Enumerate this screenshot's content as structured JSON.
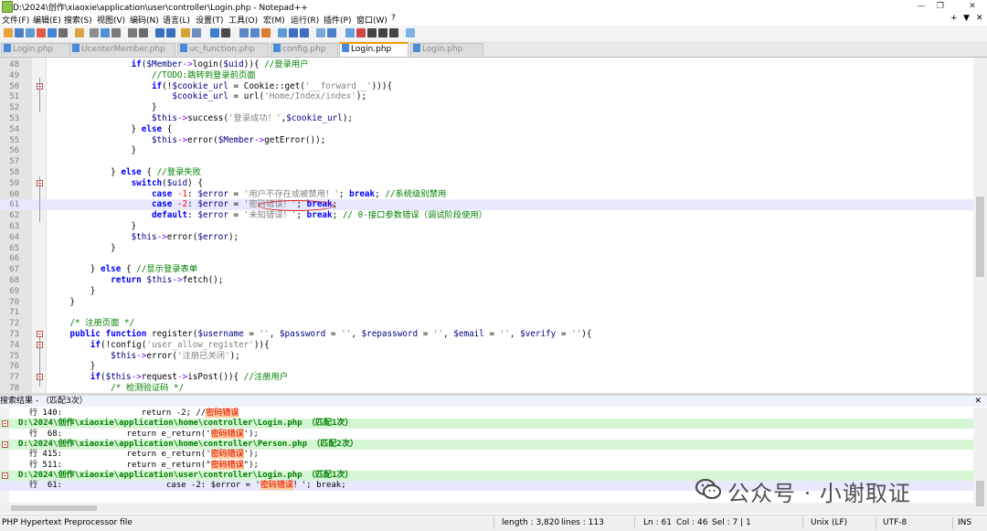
{
  "window": {
    "title": "D:\\2024\\创作\\xiaoxie\\application\\user\\controller\\Login.php - Notepad++",
    "minimize": "—",
    "restore": "❐",
    "close": "✕"
  },
  "menu": {
    "items": [
      "文件(F)",
      "编辑(E)",
      "搜索(S)",
      "视图(V)",
      "编码(N)",
      "语言(L)",
      "设置(T)",
      "工具(O)",
      "宏(M)",
      "运行(R)",
      "插件(P)",
      "窗口(W)",
      "?"
    ],
    "right": [
      "+",
      "▼",
      "✕"
    ]
  },
  "toolbar": {
    "icon_colors": [
      "#e8a33b",
      "#4a7fc9",
      "#5a9bd5",
      "#e05a4a",
      "#3f86d6",
      "#6e6e6e",
      "#d9a441",
      "#8c8c8c",
      "#4f8fd8",
      "#7a7a7a",
      "#7a7a7a",
      "#6b6b6b",
      "#3a6fc0",
      "#3a6fc0",
      "#d6a235",
      "#6b8fbf",
      "#3d7fd0",
      "#4a4a4a",
      "#5a87c7",
      "#5a87c7",
      "#d97c2b",
      "#5f9ad8",
      "#3f6dc4",
      "#3f6dc4",
      "#78a8d8",
      "#4a7fc9",
      "#66a0e0",
      "#d24545",
      "#444444",
      "#444444",
      "#444444",
      "#7fb2e5"
    ]
  },
  "tabs": [
    {
      "label": "Login.php",
      "active": false
    },
    {
      "label": "UcenterMember.php",
      "active": false
    },
    {
      "label": "uc_function.php",
      "active": false
    },
    {
      "label": "config.php",
      "active": false
    },
    {
      "label": "Login.php",
      "active": true
    },
    {
      "label": "Login.php",
      "active": false
    }
  ],
  "tab_scroll": [
    "◀",
    "▶",
    "✕"
  ],
  "editor": {
    "current_line": 61,
    "lines": [
      {
        "n": "48",
        "fold": "none",
        "tokens": [
          [
            "f",
            "                "
          ],
          [
            "k",
            "if"
          ],
          [
            "f",
            "("
          ],
          [
            "v",
            "$Member"
          ],
          [
            "o",
            "->"
          ],
          [
            "f",
            "login("
          ],
          [
            "v",
            "$uid"
          ],
          [
            "f",
            ")){ "
          ],
          [
            "c",
            "//登录用户"
          ]
        ]
      },
      {
        "n": "49",
        "fold": "none",
        "tokens": [
          [
            "c",
            "                    //TODO:跳转到登录前页面"
          ]
        ]
      },
      {
        "n": "50",
        "fold": "open",
        "tokens": [
          [
            "f",
            "                    "
          ],
          [
            "k",
            "if"
          ],
          [
            "f",
            "(!"
          ],
          [
            "v",
            "$cookie_url"
          ],
          [
            "f",
            " = Cookie::get("
          ],
          [
            "s",
            "'__forward__'"
          ],
          [
            "f",
            "))){"
          ]
        ]
      },
      {
        "n": "51",
        "fold": "none",
        "tokens": [
          [
            "f",
            "                        "
          ],
          [
            "v",
            "$cookie_url"
          ],
          [
            "f",
            " = url("
          ],
          [
            "s",
            "'Home/Index/index'"
          ],
          [
            "f",
            ");"
          ]
        ]
      },
      {
        "n": "52",
        "fold": "none",
        "tokens": [
          [
            "f",
            "                    }"
          ]
        ]
      },
      {
        "n": "53",
        "fold": "none",
        "tokens": [
          [
            "f",
            "                    "
          ],
          [
            "v",
            "$this"
          ],
          [
            "o",
            "->"
          ],
          [
            "f",
            "success("
          ],
          [
            "s",
            "'登录成功！'"
          ],
          [
            "f",
            ","
          ],
          [
            "v",
            "$cookie_url"
          ],
          [
            "f",
            ");"
          ]
        ]
      },
      {
        "n": "54",
        "fold": "none",
        "tokens": [
          [
            "f",
            "                } "
          ],
          [
            "k",
            "else"
          ],
          [
            "f",
            " {"
          ]
        ]
      },
      {
        "n": "55",
        "fold": "none",
        "tokens": [
          [
            "f",
            "                    "
          ],
          [
            "v",
            "$this"
          ],
          [
            "o",
            "->"
          ],
          [
            "f",
            "error("
          ],
          [
            "v",
            "$Member"
          ],
          [
            "o",
            "->"
          ],
          [
            "f",
            "getError());"
          ]
        ]
      },
      {
        "n": "56",
        "fold": "none",
        "tokens": [
          [
            "f",
            "                }"
          ]
        ]
      },
      {
        "n": "57",
        "fold": "none",
        "tokens": []
      },
      {
        "n": "58",
        "fold": "none",
        "tokens": [
          [
            "f",
            "            } "
          ],
          [
            "k",
            "else"
          ],
          [
            "f",
            " { "
          ],
          [
            "c",
            "//登录失败"
          ]
        ]
      },
      {
        "n": "59",
        "fold": "open",
        "tokens": [
          [
            "f",
            "                "
          ],
          [
            "k",
            "switch"
          ],
          [
            "f",
            "("
          ],
          [
            "v",
            "$uid"
          ],
          [
            "f",
            ") {"
          ]
        ]
      },
      {
        "n": "60",
        "fold": "none",
        "tokens": [
          [
            "f",
            "                    "
          ],
          [
            "k",
            "case"
          ],
          [
            "f",
            " "
          ],
          [
            "n",
            "-1"
          ],
          [
            "f",
            ": "
          ],
          [
            "v",
            "$error"
          ],
          [
            "f",
            " = "
          ],
          [
            "s",
            "'用户不存在或被禁用！'"
          ],
          [
            "f",
            "; "
          ],
          [
            "k",
            "break"
          ],
          [
            "f",
            "; "
          ],
          [
            "c",
            "//系统级别禁用"
          ]
        ]
      },
      {
        "n": "61",
        "fold": "none",
        "tokens": [
          [
            "f",
            "                    "
          ],
          [
            "k",
            "case"
          ],
          [
            "f",
            " "
          ],
          [
            "n",
            "-2"
          ],
          [
            "f",
            ": "
          ],
          [
            "v",
            "$error"
          ],
          [
            "f",
            " = "
          ],
          [
            "s",
            "'密码错误！'"
          ],
          [
            "f",
            "; "
          ],
          [
            "k",
            "break"
          ],
          [
            "f",
            ";"
          ]
        ]
      },
      {
        "n": "62",
        "fold": "none",
        "tokens": [
          [
            "f",
            "                    "
          ],
          [
            "k",
            "default"
          ],
          [
            "f",
            ": "
          ],
          [
            "v",
            "$error"
          ],
          [
            "f",
            " = "
          ],
          [
            "s",
            "'未知错误！'"
          ],
          [
            "f",
            "; "
          ],
          [
            "k",
            "break"
          ],
          [
            "f",
            "; "
          ],
          [
            "c",
            "// 0-接口参数错误（调试阶段使用）"
          ]
        ]
      },
      {
        "n": "63",
        "fold": "none",
        "tokens": [
          [
            "f",
            "                }"
          ]
        ]
      },
      {
        "n": "64",
        "fold": "none",
        "tokens": [
          [
            "f",
            "                "
          ],
          [
            "v",
            "$this"
          ],
          [
            "o",
            "->"
          ],
          [
            "f",
            "error("
          ],
          [
            "v",
            "$error"
          ],
          [
            "f",
            ");"
          ]
        ]
      },
      {
        "n": "65",
        "fold": "none",
        "tokens": [
          [
            "f",
            "            }"
          ]
        ]
      },
      {
        "n": "66",
        "fold": "none",
        "tokens": []
      },
      {
        "n": "67",
        "fold": "none",
        "tokens": [
          [
            "f",
            "        } "
          ],
          [
            "k",
            "else"
          ],
          [
            "f",
            " { "
          ],
          [
            "c",
            "//显示登录表单"
          ]
        ]
      },
      {
        "n": "68",
        "fold": "none",
        "tokens": [
          [
            "f",
            "            "
          ],
          [
            "k",
            "return"
          ],
          [
            "f",
            " "
          ],
          [
            "v",
            "$this"
          ],
          [
            "o",
            "->"
          ],
          [
            "f",
            "fetch();"
          ]
        ]
      },
      {
        "n": "69",
        "fold": "none",
        "tokens": [
          [
            "f",
            "        }"
          ]
        ]
      },
      {
        "n": "70",
        "fold": "none",
        "tokens": [
          [
            "f",
            "    }"
          ]
        ]
      },
      {
        "n": "71",
        "fold": "none",
        "tokens": []
      },
      {
        "n": "72",
        "fold": "none",
        "tokens": [
          [
            "c",
            "    /* 注册页面 */"
          ]
        ]
      },
      {
        "n": "73",
        "fold": "open",
        "tokens": [
          [
            "f",
            "    "
          ],
          [
            "k",
            "public"
          ],
          [
            "f",
            " "
          ],
          [
            "k",
            "function"
          ],
          [
            "f",
            " register("
          ],
          [
            "v",
            "$username"
          ],
          [
            "f",
            " = "
          ],
          [
            "s",
            "''"
          ],
          [
            "f",
            ", "
          ],
          [
            "v",
            "$password"
          ],
          [
            "f",
            " = "
          ],
          [
            "s",
            "''"
          ],
          [
            "f",
            ", "
          ],
          [
            "v",
            "$repassword"
          ],
          [
            "f",
            " = "
          ],
          [
            "s",
            "''"
          ],
          [
            "f",
            ", "
          ],
          [
            "v",
            "$email"
          ],
          [
            "f",
            " = "
          ],
          [
            "s",
            "''"
          ],
          [
            "f",
            ", "
          ],
          [
            "v",
            "$verify"
          ],
          [
            "f",
            " = "
          ],
          [
            "s",
            "''"
          ],
          [
            "f",
            "){"
          ]
        ]
      },
      {
        "n": "74",
        "fold": "open",
        "tokens": [
          [
            "f",
            "        "
          ],
          [
            "k",
            "if"
          ],
          [
            "f",
            "(!config("
          ],
          [
            "s",
            "'user_allow_register'"
          ],
          [
            "f",
            ")){"
          ]
        ]
      },
      {
        "n": "75",
        "fold": "none",
        "tokens": [
          [
            "f",
            "            "
          ],
          [
            "v",
            "$this"
          ],
          [
            "o",
            "->"
          ],
          [
            "f",
            "error("
          ],
          [
            "s",
            "'注册已关闭'"
          ],
          [
            "f",
            ");"
          ]
        ]
      },
      {
        "n": "76",
        "fold": "none",
        "tokens": [
          [
            "f",
            "        }"
          ]
        ]
      },
      {
        "n": "77",
        "fold": "open",
        "tokens": [
          [
            "f",
            "        "
          ],
          [
            "k",
            "if"
          ],
          [
            "f",
            "("
          ],
          [
            "v",
            "$this"
          ],
          [
            "o",
            "->"
          ],
          [
            "f",
            "request"
          ],
          [
            "o",
            "->"
          ],
          [
            "f",
            "isPost()){ "
          ],
          [
            "c",
            "//注册用户"
          ]
        ]
      },
      {
        "n": "78",
        "fold": "none",
        "tokens": [
          [
            "c",
            "            /* 检测验证码 */"
          ]
        ]
      }
    ]
  },
  "search_results": {
    "header": "搜索结果 - （匹配3次）",
    "close": "✕",
    "lines": [
      {
        "kind": "hit",
        "pre": "行 140:                return -2; //",
        "hit": "密码错误",
        "post": ""
      },
      {
        "kind": "file",
        "text": "D:\\2024\\创作\\xiaoxie\\application\\home\\controller\\Login.php （匹配1次）"
      },
      {
        "kind": "hit",
        "pre": "行  68:             return e_return('",
        "hit": "密码错误",
        "post": "');"
      },
      {
        "kind": "file",
        "text": "D:\\2024\\创作\\xiaoxie\\application\\home\\controller\\Person.php （匹配2次）"
      },
      {
        "kind": "hit",
        "pre": "行 415:             return e_return('",
        "hit": "密码错误",
        "post": "');"
      },
      {
        "kind": "hit",
        "pre": "行 511:             return e_return(\"",
        "hit": "密码错误",
        "post": "\");"
      },
      {
        "kind": "file",
        "text": "D:\\2024\\创作\\xiaoxie\\application\\user\\controller\\Login.php （匹配1次）"
      },
      {
        "kind": "sel",
        "pre": "行  61:                     case -2: $error = '",
        "hit": "密码错误",
        "post": "！'; break;"
      }
    ]
  },
  "watermark": "公众号 · 小谢取证",
  "status": {
    "lang": "PHP Hypertext Preprocessor file",
    "length": "length : 3,820",
    "lines": "lines : 113",
    "ln": "Ln : 61",
    "col": "Col : 46",
    "sel": "Sel : 7 | 1",
    "eol": "Unix (LF)",
    "enc": "UTF-8",
    "ins": "INS"
  }
}
